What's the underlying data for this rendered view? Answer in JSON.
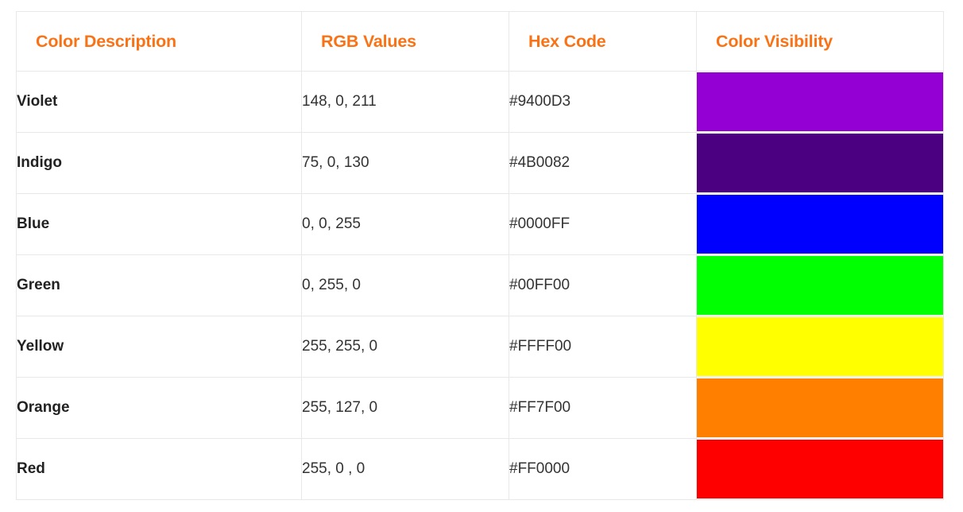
{
  "table": {
    "headers": [
      {
        "label": "Color Description"
      },
      {
        "label": "RGB Values"
      },
      {
        "label": "Hex Code"
      },
      {
        "label": "Color Visibility"
      }
    ],
    "header_text_color": "#F97316",
    "rows": [
      {
        "name": "Violet",
        "rgb": "148, 0, 211",
        "hex": "#9400D3",
        "swatch": "#9400D3"
      },
      {
        "name": "Indigo",
        "rgb": "75, 0, 130",
        "hex": "#4B0082",
        "swatch": "#4B0082"
      },
      {
        "name": "Blue",
        "rgb": "0, 0, 255",
        "hex": "#0000FF",
        "swatch": "#0000FF"
      },
      {
        "name": "Green",
        "rgb": "0, 255, 0",
        "hex": "#00FF00",
        "swatch": "#00FF00"
      },
      {
        "name": "Yellow",
        "rgb": "255, 255, 0",
        "hex": "#FFFF00",
        "swatch": "#FFFF00"
      },
      {
        "name": "Orange",
        "rgb": "255, 127, 0",
        "hex": "#FF7F00",
        "swatch": "#FF7F00"
      },
      {
        "name": "Red",
        "rgb": "255, 0 , 0",
        "hex": "#FF0000",
        "swatch": "#FF0000"
      }
    ]
  }
}
